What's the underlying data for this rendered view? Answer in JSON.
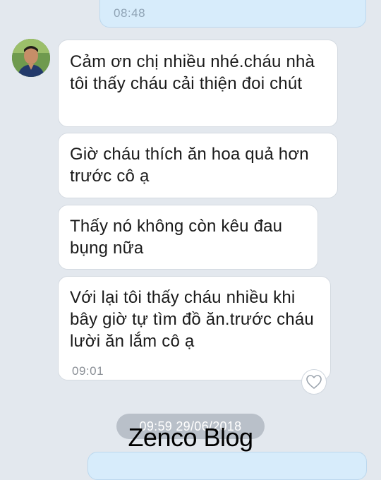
{
  "sent_message": {
    "time": "08:48"
  },
  "contact": {
    "avatar_icon": "user-avatar-photo"
  },
  "received_messages": [
    {
      "text": "Cảm ơn chị nhiều nhé.cháu nhà tôi thấy cháu cải thiện đoi chút"
    },
    {
      "text": "Giờ cháu thích ăn hoa quả hơn trước cô ạ"
    },
    {
      "text": "Thấy nó không còn kêu đau bụng nữa"
    },
    {
      "text": "Với lại tôi thấy cháu nhiều khi bây giờ tự tìm đồ ăn.trước cháu lười ăn lắm cô ạ",
      "time": "09:01"
    }
  ],
  "like_icon": "heart-icon",
  "date_separator": "09:59 29/06/2018",
  "watermark": "Zenco Blog",
  "colors": {
    "background": "#e3e8ee",
    "sent_bubble": "#d7ecfb",
    "received_bubble": "#ffffff",
    "date_pill": "#b9c0c9"
  }
}
